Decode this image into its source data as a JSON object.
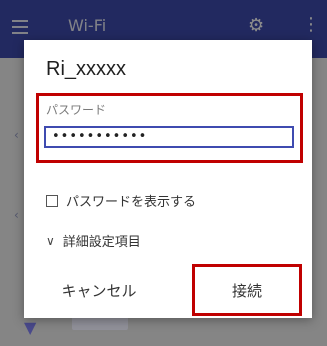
{
  "background": {
    "title": "Wi-Fi",
    "gear_icon": "gear-icon",
    "more_icon": "more-vert-icon",
    "menu_icon": "menu-icon",
    "wifi_icon": "wifi-icon"
  },
  "dialog": {
    "title": "Ri_xxxxx",
    "password_label": "パスワード",
    "password_value": "•••••••••••",
    "show_password_label": "パスワードを表示する",
    "show_password_checked": false,
    "advanced_label": "詳細設定項目",
    "cancel_label": "キャンセル",
    "connect_label": "接続"
  },
  "colors": {
    "accent": "#3f4bb0",
    "highlight": "#c00000"
  }
}
